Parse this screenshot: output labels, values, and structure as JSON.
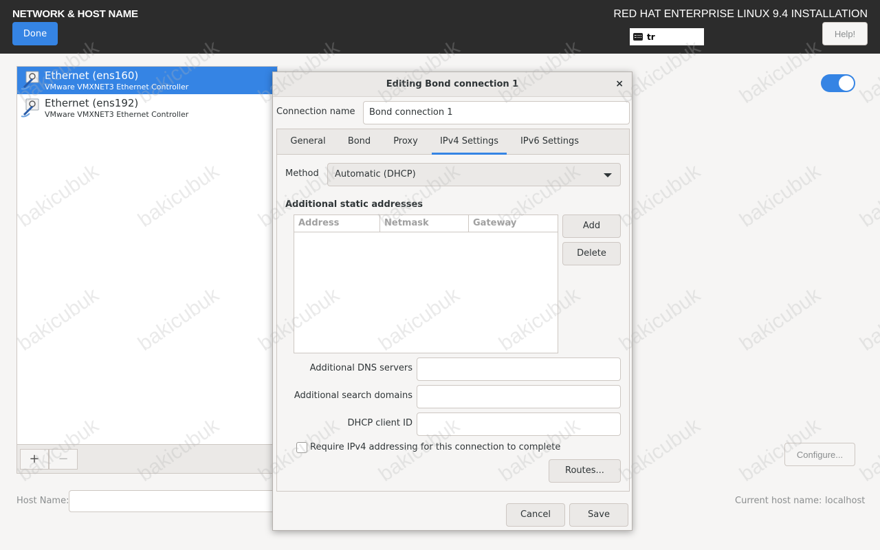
{
  "header": {
    "spoke_title": "NETWORK & HOST NAME",
    "done_label": "Done",
    "product_title": "RED HAT ENTERPRISE LINUX 9.4 INSTALLATION",
    "keyboard_layout": "tr",
    "help_label": "Help!"
  },
  "devices": [
    {
      "name": "Ethernet (ens160)",
      "subtitle": "VMware VMXNET3 Ethernet Controller",
      "selected": true
    },
    {
      "name": "Ethernet (ens192)",
      "subtitle": "VMware VMXNET3 Ethernet Controller",
      "selected": false
    }
  ],
  "list_toolbar": {
    "add_label": "+",
    "remove_label": "−"
  },
  "hostname": {
    "label": "Host Name:",
    "value": ""
  },
  "device_toggle": {
    "on": true
  },
  "configure_label": "Configure...",
  "current_host": {
    "label": "Current host name:",
    "value": "localhost"
  },
  "dialog": {
    "title": "Editing Bond connection 1",
    "close_glyph": "×",
    "connection_name_label": "Connection name",
    "connection_name_value": "Bond connection 1",
    "tabs": [
      {
        "label": "General",
        "active": false
      },
      {
        "label": "Bond",
        "active": false
      },
      {
        "label": "Proxy",
        "active": false
      },
      {
        "label": "IPv4 Settings",
        "active": true
      },
      {
        "label": "IPv6 Settings",
        "active": false
      }
    ],
    "method_label": "Method",
    "method_value": "Automatic (DHCP)",
    "static_heading": "Additional static addresses",
    "table_columns": [
      "Address",
      "Netmask",
      "Gateway"
    ],
    "add_label": "Add",
    "delete_label": "Delete",
    "dns_label": "Additional DNS servers",
    "search_label": "Additional search domains",
    "dhcp_label": "DHCP client ID",
    "require_label": "Require IPv4 addressing for this connection to complete",
    "require_checked": false,
    "routes_label": "Routes...",
    "cancel_label": "Cancel",
    "save_label": "Save"
  },
  "watermark": "bakicubuk",
  "colors": {
    "accent": "#3584e4",
    "header_bg": "#2c2c2c",
    "window_bg": "#f6f5f4"
  }
}
